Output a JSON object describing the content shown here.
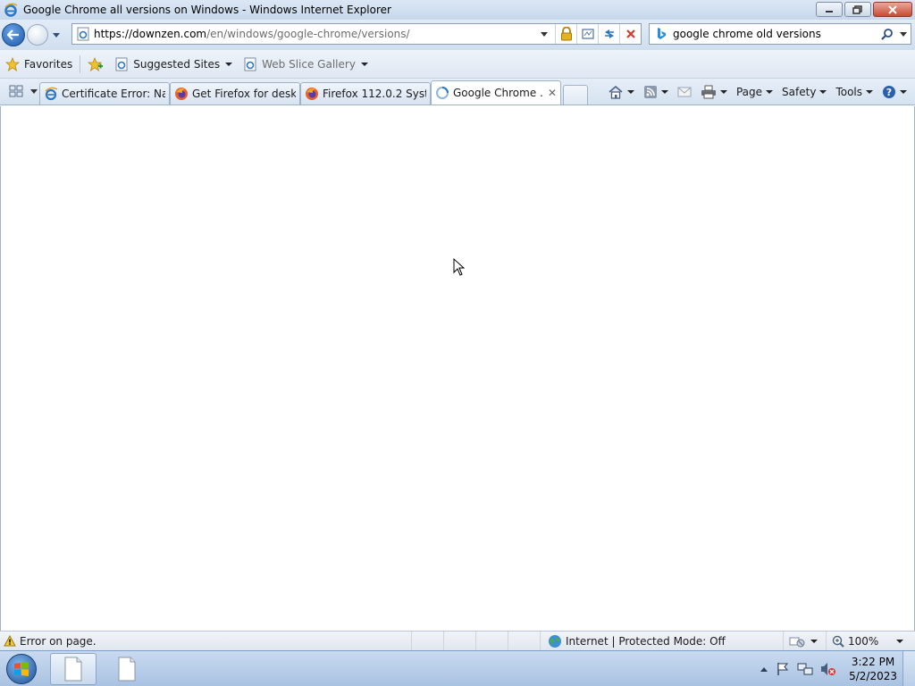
{
  "window": {
    "title": "Google Chrome all versions on Windows - Windows Internet Explorer"
  },
  "address": {
    "url_host": "https://downzen.com",
    "url_path": "/en/windows/google-chrome/versions/"
  },
  "search": {
    "value": "google chrome old versions"
  },
  "favorites_bar": {
    "favorites_label": "Favorites",
    "suggested_sites_label": "Suggested Sites",
    "web_slice_label": "Web Slice Gallery"
  },
  "tabs": [
    {
      "label": "Certificate Error: Na...",
      "icon": "ie-icon",
      "active": false
    },
    {
      "label": "Get Firefox for deskt...",
      "icon": "firefox-icon",
      "active": false
    },
    {
      "label": "Firefox 112.0.2 Syste...",
      "icon": "firefox-icon",
      "active": false
    },
    {
      "label": "Google Chrome ...",
      "icon": "loading-icon",
      "active": true
    }
  ],
  "command_bar": {
    "page_label": "Page",
    "safety_label": "Safety",
    "tools_label": "Tools"
  },
  "status_bar": {
    "message": "Error on page.",
    "zone": "Internet | Protected Mode: Off",
    "zoom": "100%"
  },
  "taskbar": {
    "time": "3:22 PM",
    "date": "5/2/2023"
  },
  "colors": {
    "accent": "#1c5aa8",
    "titlebar": "#c7d8ec",
    "close_button": "#c74b33"
  }
}
